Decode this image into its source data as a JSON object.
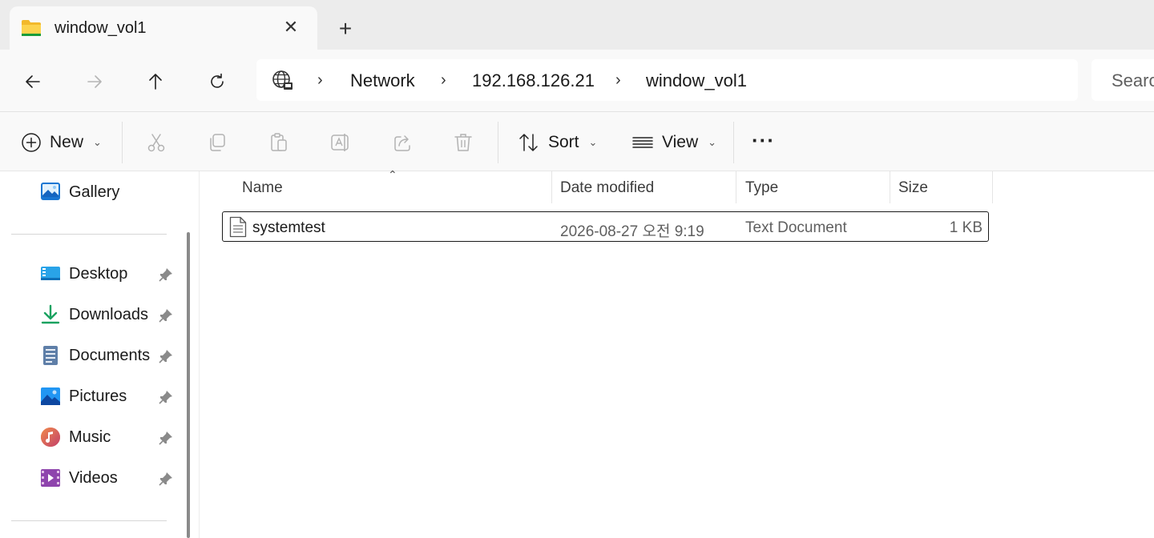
{
  "tab": {
    "title": "window_vol1",
    "close_glyph": "✕",
    "new_tab_glyph": "+"
  },
  "address": {
    "separator": "›",
    "breadcrumbs": [
      "Network",
      "192.168.126.21",
      "window_vol1"
    ],
    "search_placeholder": "Search"
  },
  "toolbar": {
    "new_label": "New",
    "sort_label": "Sort",
    "view_label": "View",
    "more_glyph": "···",
    "chevron": "⌄"
  },
  "sidebar": {
    "gallery_label": "Gallery",
    "items": [
      {
        "label": "Desktop",
        "icon": "desktop-icon"
      },
      {
        "label": "Downloads",
        "icon": "downloads-icon"
      },
      {
        "label": "Documents",
        "icon": "documents-icon"
      },
      {
        "label": "Pictures",
        "icon": "pictures-icon"
      },
      {
        "label": "Music",
        "icon": "music-icon"
      },
      {
        "label": "Videos",
        "icon": "videos-icon"
      }
    ]
  },
  "list": {
    "columns": [
      "Name",
      "Date modified",
      "Type",
      "Size"
    ],
    "sort_glyph": "⌃",
    "rows": [
      {
        "name": "systemtest",
        "date": "2026-08-27 오전 9:19",
        "type": "Text Document",
        "size": "1 KB"
      }
    ]
  },
  "colors": {
    "accent": "#0067c0",
    "folder": "#f8c43a",
    "muted_text": "#5f5f5f"
  }
}
